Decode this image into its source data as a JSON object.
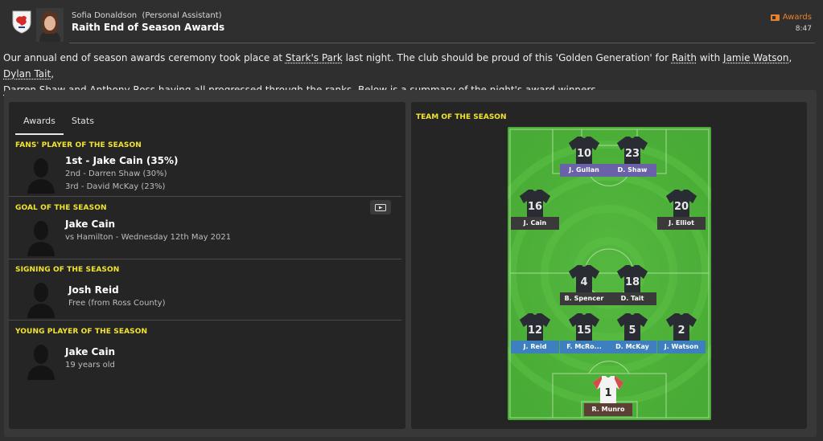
{
  "header": {
    "sender_name": "Sofia Donaldson",
    "sender_role": "(Personal Assistant)",
    "subject": "Raith End of Season Awards",
    "tag": "Awards",
    "time": "8:47",
    "icons": [
      "club-crest-icon",
      "sender-avatar",
      "tag-icon"
    ]
  },
  "intro": {
    "t1": "Our annual end of season awards ceremony took place at ",
    "stadium": "Stark's Park",
    "t2": " last night. The club should be proud of this 'Golden Generation' for ",
    "club": "Raith",
    "t3": " with ",
    "p1": "Jamie Watson",
    "sep1": ", ",
    "p2": "Dylan Tait",
    "sep2": ", ",
    "p3": "Darren Shaw",
    "and": " and ",
    "p4": "Anthony Ross",
    "t4": " having all progressed through the ranks. Below is a summary of the night's award winners."
  },
  "tabs": [
    "Awards",
    "Stats"
  ],
  "awards": {
    "fans": {
      "title": "FANS' PLAYER OF THE SEASON",
      "first": "1st - Jake Cain (35%)",
      "second": "2nd - Darren Shaw (30%)",
      "third": "3rd - David McKay (23%)"
    },
    "goal": {
      "title": "GOAL OF THE SEASON",
      "name": "Jake Cain",
      "detail": "vs Hamilton - Wednesday 12th May 2021",
      "video_icon": "play-video-icon"
    },
    "signing": {
      "title": "SIGNING OF THE SEASON",
      "name": "Josh Reid",
      "detail": "Free (from Ross County)"
    },
    "young": {
      "title": "YOUNG PLAYER OF THE SEASON",
      "name": "Jake Cain",
      "detail": "19 years old"
    }
  },
  "team": {
    "title": "TEAM OF THE SEASON",
    "players": [
      {
        "number": "10",
        "name": "J. Gullan",
        "role": "attack"
      },
      {
        "number": "23",
        "name": "D. Shaw",
        "role": "attack"
      },
      {
        "number": "16",
        "name": "J. Cain",
        "role": "midfield"
      },
      {
        "number": "20",
        "name": "J. Elliot",
        "role": "midfield"
      },
      {
        "number": "4",
        "name": "B. Spencer",
        "role": "midfield"
      },
      {
        "number": "18",
        "name": "D. Tait",
        "role": "midfield"
      },
      {
        "number": "12",
        "name": "J. Reid",
        "role": "defence"
      },
      {
        "number": "15",
        "name": "F. McRo...",
        "role": "defence"
      },
      {
        "number": "5",
        "name": "D. McKay",
        "role": "defence"
      },
      {
        "number": "2",
        "name": "J. Watson",
        "role": "defence"
      },
      {
        "number": "1",
        "name": "R. Munro",
        "role": "goalkeeper"
      }
    ]
  },
  "colors": {
    "accent_yellow": "#f2e52e",
    "tag_orange": "#e9822a",
    "attack": "#6a62a8",
    "midfield": "#3a3a3a",
    "defence": "#3e7fc0",
    "goalkeeper": "#5c4036",
    "pitch_green": "#4fb23a"
  }
}
